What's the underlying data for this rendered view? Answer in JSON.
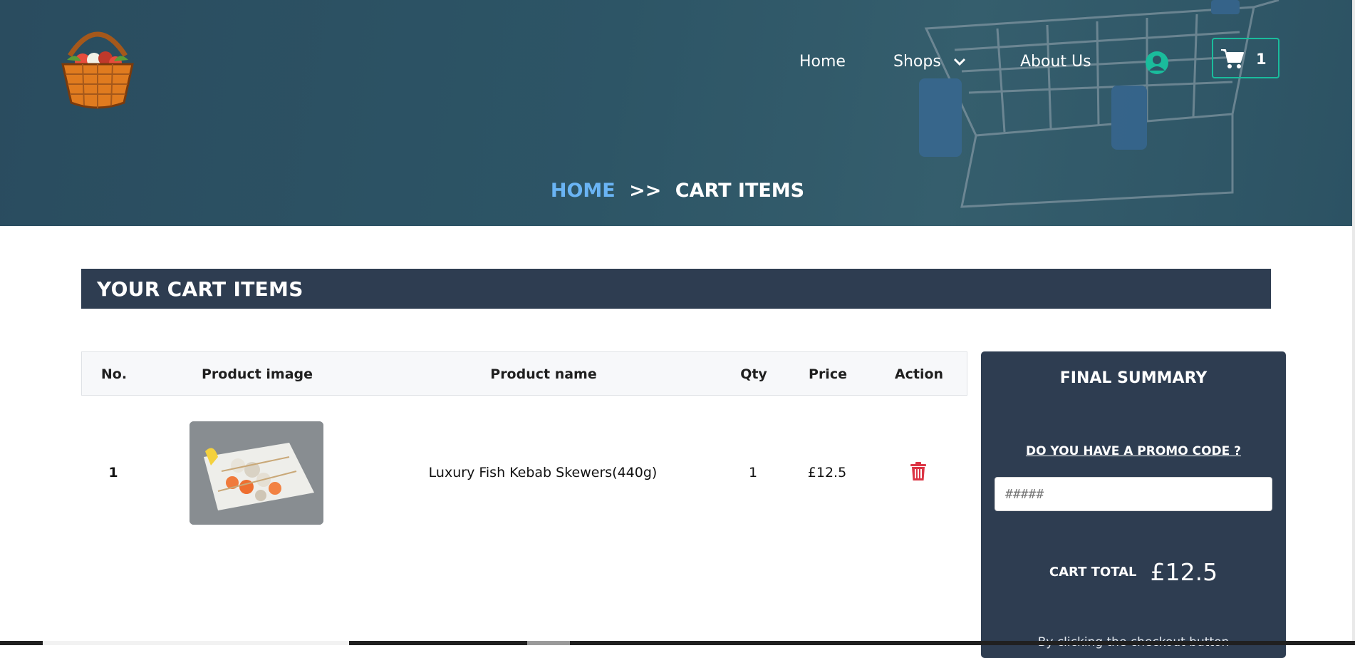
{
  "nav": {
    "home": "Home",
    "shops": "Shops",
    "about": "About Us",
    "cart_count": "1"
  },
  "breadcrumb": {
    "home": "HOME",
    "separator": ">>",
    "current": "CART ITEMS"
  },
  "section_title": "YOUR CART ITEMS",
  "table": {
    "headers": [
      "No.",
      "Product image",
      "Product name",
      "Qty",
      "Price",
      "Action"
    ],
    "rows": [
      {
        "no": "1",
        "name": "Luxury Fish Kebab Skewers(440g)",
        "qty": "1",
        "price": "£12.5"
      }
    ]
  },
  "summary": {
    "title": "FINAL SUMMARY",
    "promo_prompt": "DO YOU HAVE A PROMO CODE ?",
    "promo_placeholder": "#####",
    "cart_total_label": "CART TOTAL",
    "cart_total_value": "£12.5",
    "footnote": "By clicking the checkout button"
  },
  "icons": {
    "logo": "basket-logo",
    "user": "user-circle-icon",
    "cart": "shopping-cart-icon",
    "chevron": "chevron-down-icon",
    "trash": "trash-icon"
  },
  "colors": {
    "hero": "#2d5566",
    "dark_panel": "#2e3d51",
    "accent": "#1abc9c",
    "link_blue": "#6ab4f4",
    "delete_red": "#dc3545"
  }
}
